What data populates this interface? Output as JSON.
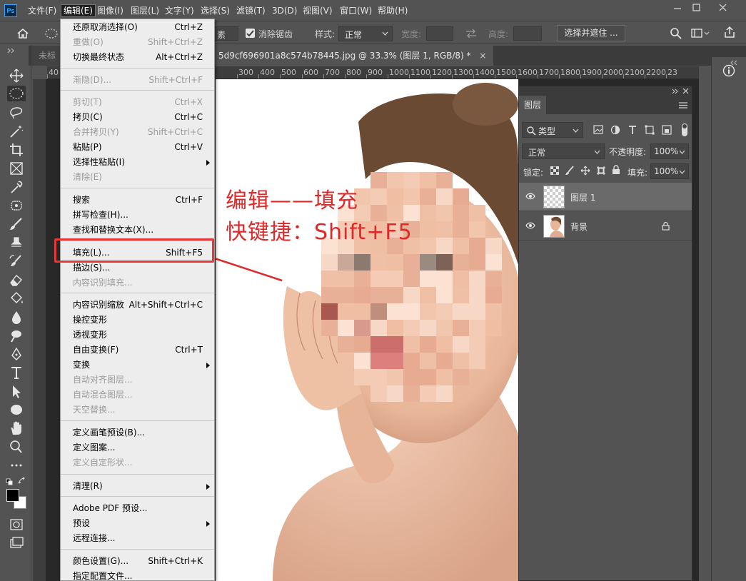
{
  "app": {
    "logo_text": "Ps"
  },
  "menubar": {
    "items": [
      "文件(F)",
      "编辑(E)",
      "图像(I)",
      "图层(L)",
      "文字(Y)",
      "选择(S)",
      "滤镜(T)",
      "3D(D)",
      "视图(V)",
      "窗口(W)",
      "帮助(H)"
    ],
    "active_index": 1,
    "window_controls": [
      "minimize",
      "maximize",
      "close"
    ]
  },
  "options_bar": {
    "feather_suffix": "素",
    "antialias_label": "消除锯齿",
    "antialias_checked": true,
    "style_label": "样式:",
    "style_value": "正常",
    "width_label": "宽度:",
    "height_label": "高度:",
    "select_mask_button": "选择并遮住 ..."
  },
  "tabs": {
    "inactive_label": "未标",
    "active_label": "5d9cf696901a8c574b78445.jpg @ 33.3% (图层 1, RGB/8) *",
    "close_glyph": "×"
  },
  "ruler": {
    "labels": [
      "40",
      "300",
      "400",
      "500",
      "600",
      "700",
      "800",
      "900",
      "1000",
      "1100",
      "1200",
      "1300",
      "1400",
      "1500",
      "1600",
      "1700",
      "1800",
      "1900",
      "2000",
      "2100",
      "2200",
      "23"
    ]
  },
  "edit_menu": {
    "items": [
      {
        "label": "还原取消选择(O)",
        "shortcut": "Ctrl+Z",
        "disabled": false
      },
      {
        "label": "重做(O)",
        "shortcut": "Shift+Ctrl+Z",
        "disabled": true
      },
      {
        "label": "切换最终状态",
        "shortcut": "Alt+Ctrl+Z",
        "disabled": false
      },
      {
        "label": "渐隐(D)...",
        "shortcut": "Shift+Ctrl+F",
        "disabled": true
      },
      {
        "label": "剪切(T)",
        "shortcut": "Ctrl+X",
        "disabled": true
      },
      {
        "label": "拷贝(C)",
        "shortcut": "Ctrl+C",
        "disabled": false
      },
      {
        "label": "合并拷贝(Y)",
        "shortcut": "Shift+Ctrl+C",
        "disabled": true
      },
      {
        "label": "粘贴(P)",
        "shortcut": "Ctrl+V",
        "disabled": false
      },
      {
        "label": "选择性粘贴(I)",
        "shortcut": "",
        "disabled": false,
        "submenu": true
      },
      {
        "label": "清除(E)",
        "shortcut": "",
        "disabled": true
      },
      {
        "label": "搜索",
        "shortcut": "Ctrl+F",
        "disabled": false
      },
      {
        "label": "拼写检查(H)...",
        "shortcut": "",
        "disabled": false
      },
      {
        "label": "查找和替换文本(X)...",
        "shortcut": "",
        "disabled": false
      },
      {
        "label": "填充(L)...",
        "shortcut": "Shift+F5",
        "disabled": false
      },
      {
        "label": "描边(S)...",
        "shortcut": "",
        "disabled": false
      },
      {
        "label": "内容识别填充...",
        "shortcut": "",
        "disabled": true
      },
      {
        "label": "内容识别缩放",
        "shortcut": "Alt+Shift+Ctrl+C",
        "disabled": false
      },
      {
        "label": "操控变形",
        "shortcut": "",
        "disabled": false
      },
      {
        "label": "透视变形",
        "shortcut": "",
        "disabled": false
      },
      {
        "label": "自由变换(F)",
        "shortcut": "Ctrl+T",
        "disabled": false
      },
      {
        "label": "变换",
        "shortcut": "",
        "disabled": false,
        "submenu": true
      },
      {
        "label": "自动对齐图层...",
        "shortcut": "",
        "disabled": true
      },
      {
        "label": "自动混合图层...",
        "shortcut": "",
        "disabled": true
      },
      {
        "label": "天空替换...",
        "shortcut": "",
        "disabled": true
      },
      {
        "label": "定义画笔预设(B)...",
        "shortcut": "",
        "disabled": false
      },
      {
        "label": "定义图案...",
        "shortcut": "",
        "disabled": false
      },
      {
        "label": "定义自定形状...",
        "shortcut": "",
        "disabled": true
      },
      {
        "label": "清理(R)",
        "shortcut": "",
        "disabled": false,
        "submenu": true
      },
      {
        "label": "Adobe PDF 预设...",
        "shortcut": "",
        "disabled": false
      },
      {
        "label": "预设",
        "shortcut": "",
        "disabled": false,
        "submenu": true
      },
      {
        "label": "远程连接...",
        "shortcut": "",
        "disabled": false
      },
      {
        "label": "颜色设置(G)...",
        "shortcut": "Shift+Ctrl+K",
        "disabled": false
      },
      {
        "label": "指定配置文件...",
        "shortcut": "",
        "disabled": false
      }
    ]
  },
  "annotation": {
    "line1": "编辑——填充",
    "line2": "快键捷：Shift+F5",
    "color": "#e02828"
  },
  "layers_panel": {
    "title": "图层",
    "filter_label": "类型",
    "blend_mode": "正常",
    "opacity_label": "不透明度:",
    "opacity_value": "100%",
    "lock_label": "锁定:",
    "fill_label": "填充:",
    "fill_value": "100%",
    "layers": [
      {
        "name": "图层 1",
        "visible": true,
        "selected": true,
        "locked": false
      },
      {
        "name": "背景",
        "visible": true,
        "selected": false,
        "locked": true
      }
    ]
  }
}
